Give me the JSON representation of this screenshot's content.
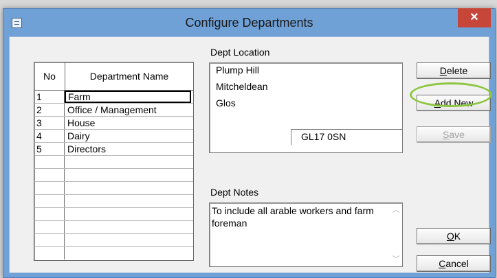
{
  "window": {
    "title": "Configure Departments",
    "close_glyph": "✕"
  },
  "grid": {
    "headers": {
      "no": "No",
      "name": "Department Name"
    },
    "rows": [
      {
        "no": "1",
        "name": "Farm"
      },
      {
        "no": "2",
        "name": "Office / Management"
      },
      {
        "no": "3",
        "name": "House"
      },
      {
        "no": "4",
        "name": "Dairy"
      },
      {
        "no": "5",
        "name": "Directors"
      }
    ]
  },
  "location": {
    "label": "Dept Location",
    "lines": [
      "Plump Hill",
      "Mitcheldean",
      "Glos"
    ],
    "postcode": "GL17 0SN"
  },
  "notes": {
    "label": "Dept Notes",
    "text": "To include all arable workers and farm foreman"
  },
  "buttons": {
    "delete": {
      "mn": "D",
      "rest": "elete"
    },
    "add_new": {
      "mn": "A",
      "rest": "dd New"
    },
    "save": {
      "mn": "S",
      "rest": "ave"
    },
    "ok": {
      "mn": "O",
      "rest": "K"
    },
    "cancel": {
      "mn": "C",
      "rest": "ancel"
    }
  },
  "colors": {
    "titlebar": "#6fa0d6",
    "close": "#c7463a",
    "highlight_ring": "#8cc63f"
  }
}
